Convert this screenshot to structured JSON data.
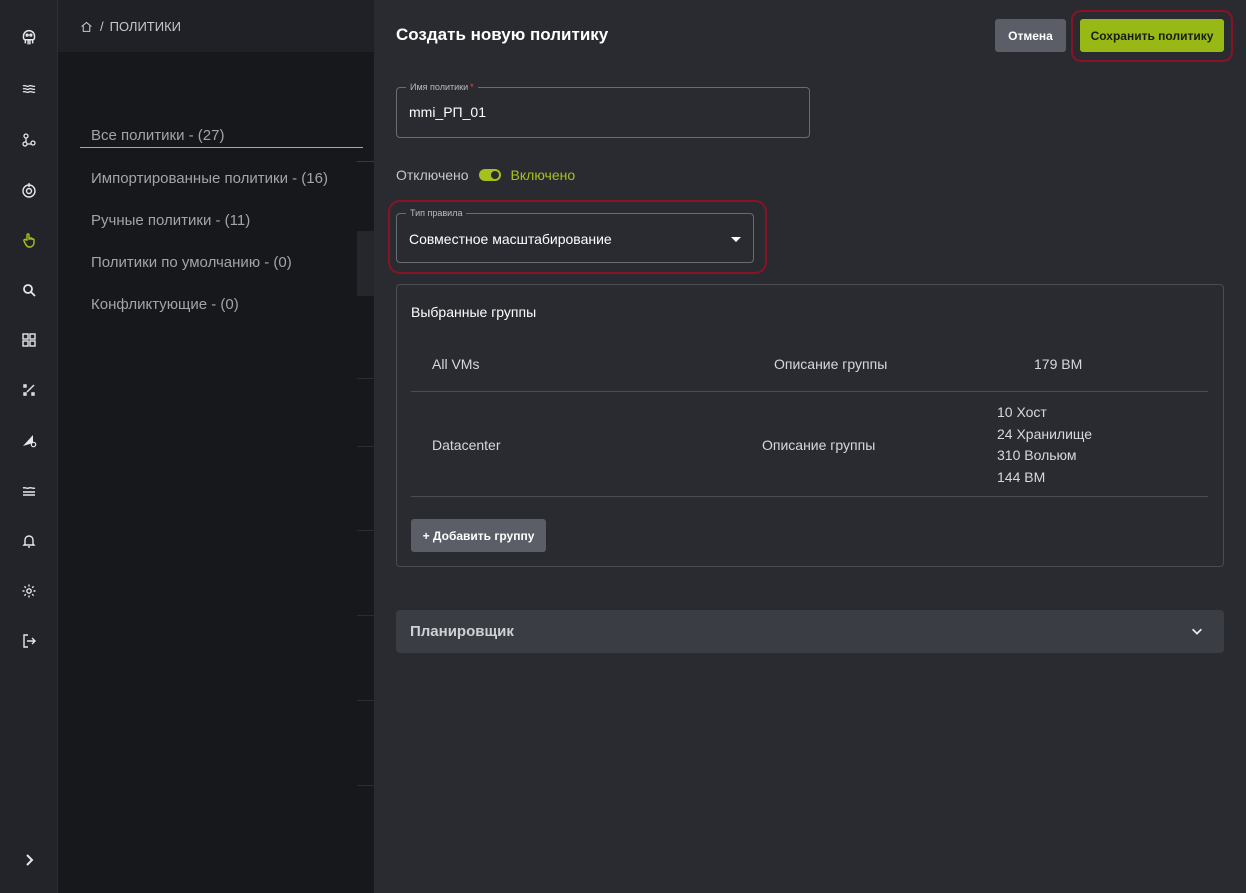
{
  "breadcrumb": {
    "separator": "/",
    "current": "ПОЛИТИКИ"
  },
  "rail": {
    "icons": [
      "logo-octopus-icon",
      "layers-icon",
      "nodes-icon",
      "radar-icon",
      "hand-pointer-icon",
      "search-icon",
      "grid-icon",
      "sparkle-grid-icon",
      "wrench-triangle-icon",
      "stack-lines-icon",
      "bell-icon",
      "gear-icon",
      "logout-icon",
      "expand-chevron-icon"
    ],
    "active": "hand-pointer-icon"
  },
  "filters": [
    {
      "label": "Все политики - (27)"
    },
    {
      "label": "Импортированные политики - (16)"
    },
    {
      "label": "Ручные политики - (11)"
    },
    {
      "label": "Политики по умолчанию - (0)"
    },
    {
      "label": "Конфликтующие - (0)"
    }
  ],
  "drawer": {
    "title": "Создать новую политику",
    "cancel_label": "Отмена",
    "save_label": "Сохранить политику",
    "policy_name": {
      "label": "Имя политики",
      "required_mark": "*",
      "value": "mmi_РП_01"
    },
    "toggle": {
      "off_label": "Отключено",
      "on_label": "Включено",
      "state": "on"
    },
    "rule_type": {
      "label": "Тип правила",
      "value": "Совместное масштабирование"
    },
    "groups": {
      "title": "Выбранные группы",
      "rows": [
        {
          "name": "All VMs",
          "description": "Описание группы",
          "stats": [
            "179 ВМ"
          ]
        },
        {
          "name": "Datacenter",
          "description": "Описание группы",
          "stats": [
            "10 Хост",
            "24 Хранилище",
            "310 Вольюм",
            "144 ВМ"
          ]
        }
      ],
      "add_label": "+ Добавить группу"
    },
    "scheduler_label": "Планировщик"
  },
  "colors": {
    "accent": "#98b815",
    "highlight": "#8a1226",
    "panel": "#2a2b31",
    "rail": "#232429"
  }
}
